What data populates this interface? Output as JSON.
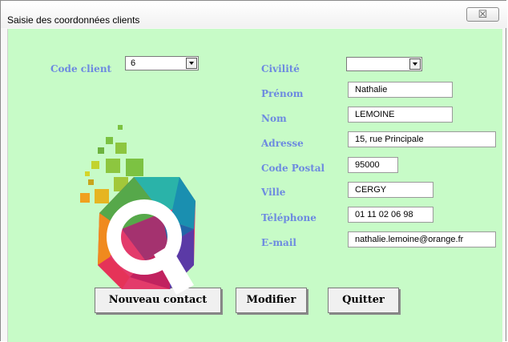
{
  "window": {
    "title": "Saisie des coordonnées clients",
    "close_glyph": "☒"
  },
  "form": {
    "code_client": {
      "label": "Code client",
      "value": "6"
    },
    "civilite": {
      "label": "Civilité",
      "value": ""
    },
    "prenom": {
      "label": "Prénom",
      "value": "Nathalie"
    },
    "nom": {
      "label": "Nom",
      "value": "LEMOINE"
    },
    "adresse": {
      "label": "Adresse",
      "value": "15, rue Principale"
    },
    "code_postal": {
      "label": "Code Postal",
      "value": "95000"
    },
    "ville": {
      "label": "Ville",
      "value": "CERGY"
    },
    "telephone": {
      "label": "Téléphone",
      "value": "01 11 02 06 98"
    },
    "email": {
      "label": "E-mail",
      "value": "nathalie.lemoine@orange.fr"
    }
  },
  "buttons": {
    "nouveau": "Nouveau contact",
    "modifier": "Modifier",
    "quitter": "Quitter"
  },
  "colors": {
    "background": "#c7fbc7",
    "label": "#6d8ae0"
  },
  "logo": {
    "icon": "q-logo-icon"
  }
}
